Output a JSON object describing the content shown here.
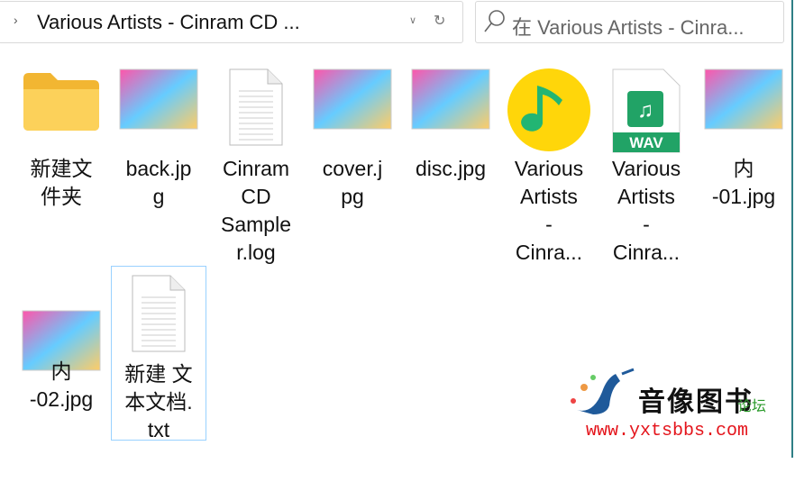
{
  "address_bar": {
    "separator": "›",
    "path": "Various Artists - Cinram CD ...",
    "dropdown_icon": "chevron-down-icon",
    "refresh_icon": "refresh-icon"
  },
  "search": {
    "placeholder": "在 Various Artists - Cinra...",
    "icon": "search-icon"
  },
  "files": [
    {
      "label": "新建文\n件夹",
      "type": "folder"
    },
    {
      "label": "back.jp\ng",
      "type": "image"
    },
    {
      "label": "Cinram\nCD\nSample\nr.log",
      "type": "text"
    },
    {
      "label": "cover.j\npg",
      "type": "image"
    },
    {
      "label": "disc.jpg",
      "type": "image"
    },
    {
      "label": "Various\nArtists\n-\nCinra...",
      "type": "audio-app"
    },
    {
      "label": "Various\nArtists\n-\nCinra...",
      "type": "wav",
      "badge": "WAV"
    },
    {
      "label": "内\n-01.jpg",
      "type": "image"
    },
    {
      "label": "内\n-02.jpg",
      "type": "image"
    },
    {
      "label": "新建 文\n本文档.\ntxt",
      "type": "text",
      "selected": true
    }
  ],
  "watermark": {
    "title": "音像图书",
    "subtitle": "论坛",
    "url": "www.yxtsbbs.com"
  },
  "colors": {
    "folder": "#f7c948",
    "wav": "#21a366",
    "qq_music": "#ffd60a",
    "selection_border": "#99d1ff",
    "url": "#e4141b"
  }
}
